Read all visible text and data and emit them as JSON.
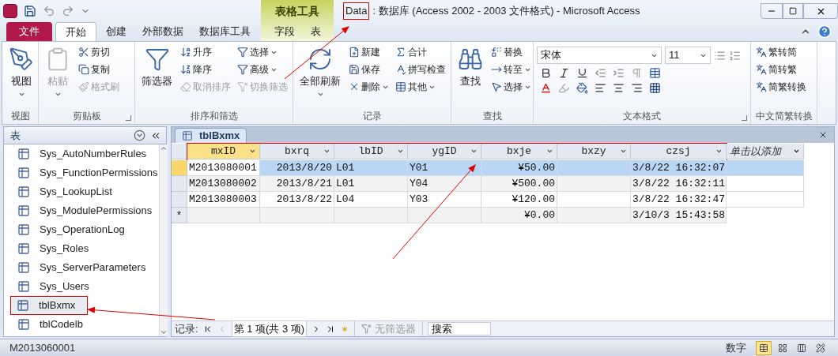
{
  "window": {
    "title_highlight": "Data",
    "title": ": 数据库 (Access 2002 - 2003 文件格式)  -  Microsoft Access",
    "title_boxed": true
  },
  "context_group": {
    "label": "表格工具"
  },
  "tabs": [
    {
      "label": "文件",
      "kind": "file",
      "selected": false
    },
    {
      "label": "开始",
      "kind": "main",
      "selected": true
    },
    {
      "label": "创建",
      "kind": "main",
      "selected": false
    },
    {
      "label": "外部数据",
      "kind": "main",
      "selected": false
    },
    {
      "label": "数据库工具",
      "kind": "main",
      "selected": false
    },
    {
      "label": "字段",
      "kind": "context",
      "selected": false
    },
    {
      "label": "表",
      "kind": "context",
      "selected": false
    }
  ],
  "ribbon": [
    {
      "kind": "buttons",
      "title": "视图",
      "launcher": false,
      "large": [
        {
          "label": "视图",
          "dropdown": true,
          "disabled": false
        }
      ]
    },
    {
      "kind": "buttons",
      "title": "剪贴板",
      "launcher": true,
      "large": [
        {
          "label": "粘贴",
          "dropdown": true,
          "disabled": true
        }
      ],
      "small": [
        {
          "label": "剪切",
          "dropdown": false,
          "disabled": false
        },
        {
          "label": "复制",
          "dropdown": false,
          "disabled": false
        },
        {
          "label": "格式刷",
          "dropdown": false,
          "disabled": true
        }
      ]
    },
    {
      "kind": "buttons",
      "title": "排序和筛选",
      "launcher": false,
      "large": [
        {
          "label": "筛选器",
          "dropdown": false,
          "disabled": false
        }
      ],
      "small": [
        {
          "label": "升序",
          "dropdown": false,
          "disabled": false
        },
        {
          "label": "降序",
          "dropdown": false,
          "disabled": false
        },
        {
          "label": "取消排序",
          "dropdown": false,
          "disabled": true
        },
        {
          "label": "选择",
          "dropdown": true,
          "disabled": false
        },
        {
          "label": "高级",
          "dropdown": true,
          "disabled": false
        },
        {
          "label": "切换筛选",
          "dropdown": false,
          "disabled": true
        }
      ]
    },
    {
      "kind": "buttons",
      "title": "记录",
      "launcher": false,
      "large": [
        {
          "label": "全部刷新",
          "dropdown": true,
          "disabled": false
        }
      ],
      "small": [
        {
          "label": "新建",
          "dropdown": false,
          "disabled": false
        },
        {
          "label": "保存",
          "dropdown": false,
          "disabled": false
        },
        {
          "label": "删除",
          "dropdown": true,
          "disabled": false
        },
        {
          "label": "合计",
          "dropdown": false,
          "disabled": false
        },
        {
          "label": "拼写检查",
          "dropdown": false,
          "disabled": false
        },
        {
          "label": "其他",
          "dropdown": true,
          "disabled": false
        }
      ]
    },
    {
      "kind": "buttons",
      "title": "查找",
      "launcher": false,
      "large": [
        {
          "label": "查找",
          "dropdown": false,
          "disabled": false
        }
      ],
      "small": [
        {
          "label": "替换",
          "dropdown": false,
          "disabled": false
        },
        {
          "label": "转至",
          "dropdown": true,
          "disabled": false
        },
        {
          "label": "选择",
          "dropdown": true,
          "disabled": false
        }
      ]
    },
    {
      "kind": "format",
      "title": "文本格式",
      "launcher": true,
      "font": "宋体",
      "size": "11"
    },
    {
      "kind": "buttons",
      "title": "中文简繁转换",
      "launcher": false,
      "small": [
        {
          "label": "繁转简",
          "dropdown": false,
          "disabled": false
        },
        {
          "label": "简转繁",
          "dropdown": false,
          "disabled": false
        },
        {
          "label": "简繁转换",
          "dropdown": false,
          "disabled": false
        }
      ]
    }
  ],
  "nav": {
    "header": "表",
    "items": [
      {
        "label": "Sys_AutoNumberRules",
        "selected": false,
        "boxed": false
      },
      {
        "label": "Sys_FunctionPermissions",
        "selected": false,
        "boxed": false
      },
      {
        "label": "Sys_LookupList",
        "selected": false,
        "boxed": false
      },
      {
        "label": "Sys_ModulePermissions",
        "selected": false,
        "boxed": false
      },
      {
        "label": "Sys_OperationLog",
        "selected": false,
        "boxed": false
      },
      {
        "label": "Sys_Roles",
        "selected": false,
        "boxed": false
      },
      {
        "label": "Sys_ServerParameters",
        "selected": false,
        "boxed": false
      },
      {
        "label": "Sys_Users",
        "selected": false,
        "boxed": false
      },
      {
        "label": "tblBxmx",
        "selected": true,
        "boxed": true
      },
      {
        "label": "tblCodelb",
        "selected": false,
        "boxed": false
      }
    ]
  },
  "document_tab": {
    "label": "tblBxmx"
  },
  "table": {
    "header_boxed": true,
    "add_column": "单击以添加",
    "columns": [
      {
        "name": "mxID",
        "kind": "text"
      },
      {
        "name": "bxrq",
        "kind": "date"
      },
      {
        "name": "lbID",
        "kind": "text"
      },
      {
        "name": "ygID",
        "kind": "text"
      },
      {
        "name": "bxje",
        "kind": "currency"
      },
      {
        "name": "bxzy",
        "kind": "text"
      },
      {
        "name": "czsj",
        "kind": "datetime"
      }
    ],
    "rows": [
      {
        "selected": true,
        "cells": [
          "M2013080001",
          "2013/8/20",
          "L01",
          "Y01",
          "¥50.00",
          null,
          "3/8/22 16:32:07"
        ]
      },
      {
        "selected": false,
        "cells": [
          "M2013080002",
          "2013/8/21",
          "L01",
          "Y04",
          "¥500.00",
          null,
          "3/8/22 16:32:11"
        ]
      },
      {
        "selected": false,
        "cells": [
          "M2013080003",
          "2013/8/22",
          "L04",
          "Y03",
          "¥120.00",
          null,
          "3/8/22 16:32:47"
        ]
      }
    ],
    "new_row": {
      "marker": "*",
      "cells": [
        null,
        null,
        null,
        null,
        "¥0.00",
        null,
        "3/10/3 15:43:58"
      ]
    }
  },
  "record_nav": {
    "label": "记录:",
    "position": "第 1 项(共 3 项)",
    "filter": "无筛选器",
    "search": {
      "placeholder": "搜索"
    }
  },
  "status_bar": {
    "text": "M2013060001",
    "mode": "数字",
    "views": [
      {
        "selected": true
      },
      {
        "selected": false
      },
      {
        "selected": false
      },
      {
        "selected": false
      }
    ]
  }
}
